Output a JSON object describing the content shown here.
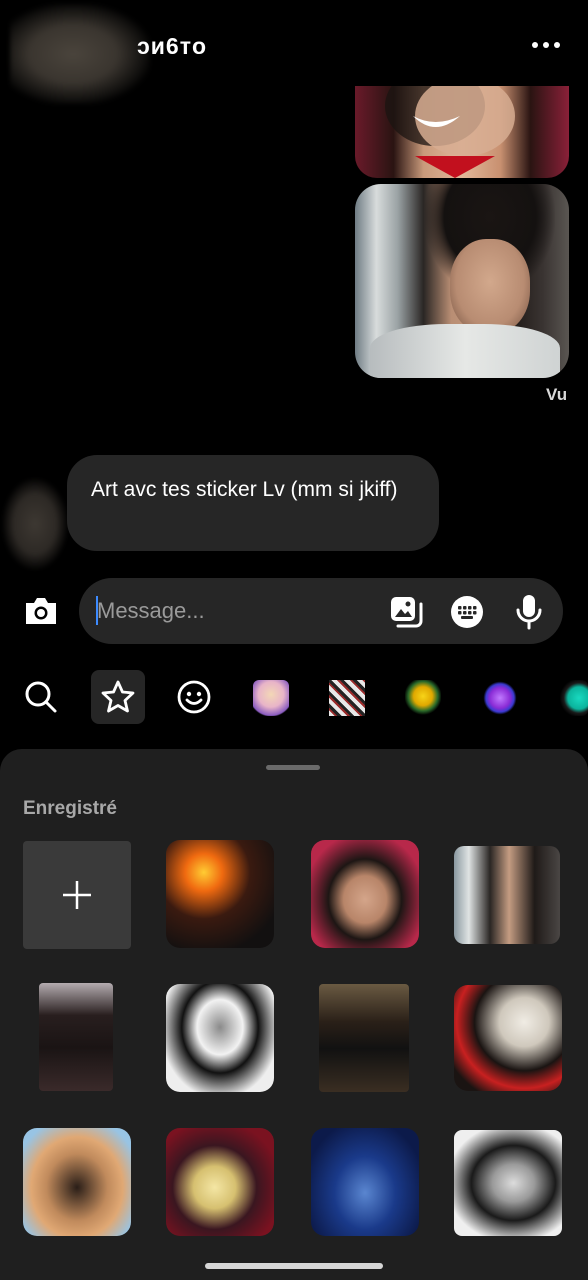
{
  "header": {
    "username": "ᴐᴎ6ᴛo",
    "more_icon": "more-horizontal-icon"
  },
  "conversation": {
    "seen_status": "Vu",
    "incoming_message": "Art avc tes sticker Lv (mm si jkiff)"
  },
  "composer": {
    "placeholder": "Message...",
    "camera_icon": "camera-icon",
    "gallery_icon": "gallery-icon",
    "sticker_icon": "sticker-icon",
    "mic_icon": "microphone-icon"
  },
  "sticker_tabs": [
    "search-icon",
    "star-icon",
    "smiley-icon",
    "sticker-pack-1",
    "sticker-pack-2",
    "sticker-pack-3",
    "sticker-pack-4",
    "sticker-pack-5"
  ],
  "sticker_sheet": {
    "section_title": "Enregistré",
    "add_icon": "plus-icon",
    "sticker_count": 11
  },
  "colors": {
    "background": "#000000",
    "bubble": "#262626",
    "sheet": "#1f1f1f",
    "caret": "#3d8bff"
  }
}
